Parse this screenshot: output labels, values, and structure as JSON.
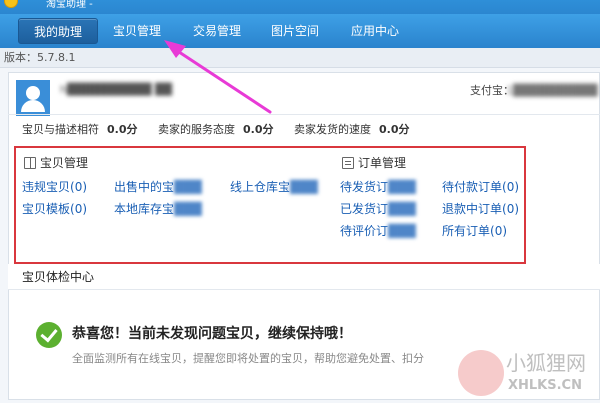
{
  "app": {
    "title": "淘宝助理 -"
  },
  "nav": {
    "tabs": [
      {
        "label": "我的助理",
        "active": true
      },
      {
        "label": "宝贝管理",
        "active": false
      },
      {
        "label": "交易管理",
        "active": false
      },
      {
        "label": "图片空间",
        "active": false
      },
      {
        "label": "应用中心",
        "active": false
      }
    ]
  },
  "version": {
    "text": "版本：5.7.8.1"
  },
  "user": {
    "name": "h██████████ ██",
    "alipay_label": "支付宝：",
    "alipay_value": "1██████████"
  },
  "ratings": [
    {
      "label": "宝贝与描述相符",
      "value": "0.0分"
    },
    {
      "label": "卖家的服务态度",
      "value": "0.0分"
    },
    {
      "label": "卖家发货的速度",
      "value": "0.0分"
    }
  ],
  "item_mgmt": {
    "title": "宝贝管理",
    "links": [
      {
        "label": "违规宝贝",
        "count": "(0)"
      },
      {
        "label": "出售中的宝",
        "blurred": "███"
      },
      {
        "label": "线上仓库宝",
        "blurred": "███"
      },
      {
        "label": "宝贝模板",
        "count": "(0)"
      },
      {
        "label": "本地库存宝",
        "blurred": "███"
      }
    ]
  },
  "order_mgmt": {
    "title": "订单管理",
    "links": [
      {
        "label": "待发货订",
        "blurred": "███"
      },
      {
        "label": "待付款订单",
        "count": "(0)"
      },
      {
        "label": "已发货订",
        "blurred": "███"
      },
      {
        "label": "退款中订单",
        "count": "(0)"
      },
      {
        "label": "待评价订",
        "blurred": "███"
      },
      {
        "label": "所有订单",
        "count": "(0)"
      }
    ]
  },
  "check": {
    "header": "宝贝体检中心",
    "headline": "恭喜您！当前未发现问题宝贝，继续保持哦！",
    "description": "全面监测所有在线宝贝，提醒您即将处置的宝贝，帮助您避免处置、扣分"
  },
  "watermark": {
    "text": "小狐狸网",
    "sub": "XHLKS.CN"
  },
  "colors": {
    "nav": "#2a83cd",
    "highlight": "#d9373e",
    "link": "#1a5fb4",
    "check": "#5cb030",
    "arrow": "#e83ad6"
  }
}
